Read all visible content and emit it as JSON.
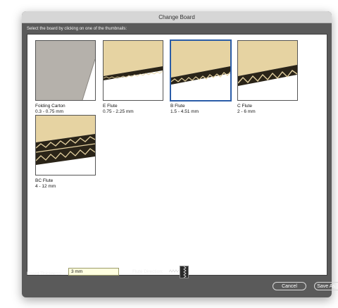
{
  "window": {
    "title": "Change Board"
  },
  "instruction": "Select the board by clicking on one of the thumbnails:",
  "boards": [
    {
      "name": "Folding Carton",
      "range": "0.3 - 0.75 mm"
    },
    {
      "name": "E Flute",
      "range": "0.75 - 2.25 mm"
    },
    {
      "name": "B Flute",
      "range": "1.5 - 4.51 mm"
    },
    {
      "name": "C Flute",
      "range": "2 - 6 mm"
    },
    {
      "name": "BC Flute",
      "range": "4 - 12 mm"
    }
  ],
  "selected_board": "B Flute",
  "thickness": {
    "label": "Board Thickness:",
    "value": "3 mm"
  },
  "flute_direction": {
    "label": "Flute Direction:",
    "icon": "flute-direction-icon"
  },
  "buttons": {
    "cancel": "Cancel",
    "save_as": "Save As..."
  },
  "colors": {
    "board": "#e6d3a2",
    "window": "#5a5a5a",
    "selection": "#2b5da8"
  }
}
